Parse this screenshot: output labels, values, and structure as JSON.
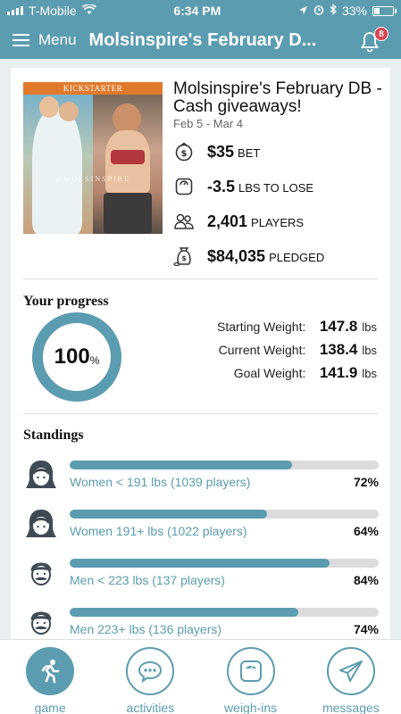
{
  "status_bar": {
    "carrier": "T-Mobile",
    "time": "6:34 PM",
    "battery": "33%",
    "battery_level": 0.33
  },
  "header": {
    "menu_label": "Menu",
    "title": "Molsinspire's February D...",
    "notification_count": "8"
  },
  "game": {
    "banner_label": "KICKSTARTER",
    "watermark": "@MOLSINSPIRE",
    "title": "Molsinspire's February DB - Cash giveaways!",
    "dates": "Feb 5 - Mar 4",
    "stats": {
      "bet": {
        "value": "$35",
        "unit": "BET",
        "icon": "money-bag-icon"
      },
      "lose": {
        "value": "-3.5",
        "unit": "LBS TO LOSE",
        "icon": "scale-icon"
      },
      "players": {
        "value": "2,401",
        "unit": "PLAYERS",
        "icon": "people-icon"
      },
      "pledged": {
        "value": "$84,035",
        "unit": "PLEDGED",
        "icon": "coins-icon"
      }
    }
  },
  "progress": {
    "title": "Your progress",
    "percent_value": "100",
    "percent_sign": "%",
    "percent": 1.0,
    "starting_label": "Starting Weight:",
    "starting_value": "147.8",
    "current_label": "Current Weight:",
    "current_value": "138.4",
    "goal_label": "Goal Weight:",
    "goal_value": "141.9",
    "unit": "lbs"
  },
  "standings": {
    "title": "Standings",
    "items": [
      {
        "label": "Women < 191 lbs (1039 players)",
        "pct_text": "72%",
        "pct": 0.72,
        "avatar": "woman-avatar-icon"
      },
      {
        "label": "Women 191+ lbs (1022 players)",
        "pct_text": "64%",
        "pct": 0.64,
        "avatar": "woman-avatar-icon"
      },
      {
        "label": "Men < 223 lbs (137 players)",
        "pct_text": "84%",
        "pct": 0.84,
        "avatar": "man-avatar-icon"
      },
      {
        "label": "Men 223+ lbs (136 players)",
        "pct_text": "74%",
        "pct": 0.74,
        "avatar": "man-avatar-icon"
      }
    ]
  },
  "tabs": [
    {
      "label": "game",
      "icon": "runner-icon",
      "active": true
    },
    {
      "label": "activities",
      "icon": "chat-bubble-icon",
      "active": false
    },
    {
      "label": "weigh-ins",
      "icon": "scale-icon",
      "active": false
    },
    {
      "label": "messages",
      "icon": "paper-plane-icon",
      "active": false
    }
  ],
  "colors": {
    "accent": "#5b9cb0",
    "badge": "#d9434e",
    "kickstarter": "#e07b2d"
  }
}
